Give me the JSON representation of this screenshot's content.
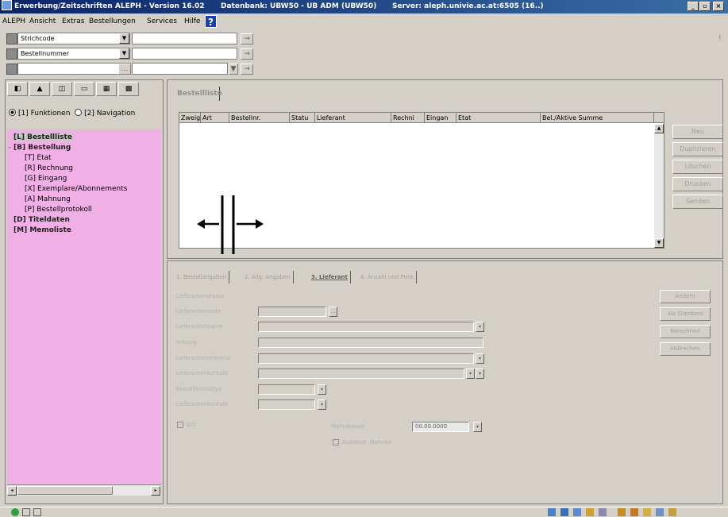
{
  "window": {
    "title": "Erwerbung/Zeitschriften ALEPH - Version 16.02",
    "database": "Datenbank: UBW50 - UB ADM (UBW50)",
    "server": "Server: aleph.univie.ac.at:6505 (16..)",
    "min_label": "_",
    "max_label": "▫",
    "close_label": "×"
  },
  "menu": {
    "items": [
      "ALEPH",
      "Ansicht",
      "Extras",
      "Bestellungen",
      "Services",
      "Hilfe"
    ],
    "help_label": "?"
  },
  "search": {
    "row1_select": "Strichcode",
    "row2_select": "Bestellnummer",
    "go_label": "→",
    "dots_label": "…",
    "dropdown_label": "▼"
  },
  "left_panel": {
    "tabs": [
      "◧",
      "▲",
      "◫",
      "▭",
      "▦",
      "▩"
    ],
    "radio1": "[1] Funktionen",
    "radio2": "[2] Navigation",
    "tree": [
      {
        "label": "[L] Bestellliste",
        "level": 0,
        "bold": true
      },
      {
        "label": "[B] Bestellung",
        "level": 0,
        "bold": true
      },
      {
        "label": "[T] Etat",
        "level": 1,
        "bold": false
      },
      {
        "label": "[R] Rechnung",
        "level": 1,
        "bold": false
      },
      {
        "label": "[G] Eingang",
        "level": 1,
        "bold": false
      },
      {
        "label": "[X] Exemplare/Abonnements",
        "level": 1,
        "bold": false
      },
      {
        "label": "[A] Mahnung",
        "level": 1,
        "bold": false
      },
      {
        "label": "[P] Bestellprotokoll",
        "level": 1,
        "bold": false
      },
      {
        "label": "[D] Titeldaten",
        "level": 0,
        "bold": true
      },
      {
        "label": "[M] Memoliste",
        "level": 0,
        "bold": true
      }
    ]
  },
  "order_list": {
    "tab_label": "Bestellliste",
    "columns": [
      "Zweig",
      "Art",
      "Bestellnr.",
      "Statu",
      "Lieferant",
      "Rechni",
      "Eingan",
      "Etat",
      "Bel./Aktive Summe"
    ],
    "buttons": [
      "Neu",
      "Duplizieren",
      "Löschen",
      "Drucken",
      "Senden"
    ],
    "scroll_up": "▲",
    "scroll_down": "▼"
  },
  "order_form": {
    "tabs": [
      "1. Bestellangaben",
      "2. Allg. Angaben",
      "3. Lieferant",
      "4. Anzahl und Preis"
    ],
    "labels": [
      "Lieferantenstatus",
      "Lieferantencode",
      "Lieferantenname",
      "Anhang",
      "Lieferantenreferenz",
      "Lieferantenkontakt",
      "Bestellformattyp",
      "Lieferantenkontakt"
    ],
    "checkbox1": "EDI",
    "date_label": "Mahndatum",
    "date_value": "00.00.0000",
    "checkbox2": "Automat. Mahnen",
    "buttons": [
      "Ändern",
      "Als Standard",
      "Berechnen",
      "Abbrechen"
    ],
    "lookup_label": "…",
    "arrow_label": "▾"
  }
}
